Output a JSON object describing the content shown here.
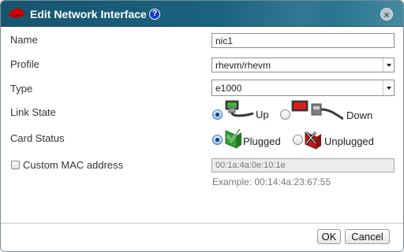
{
  "dialog": {
    "title": "Edit Network Interface",
    "help_glyph": "?",
    "close_glyph": "×"
  },
  "form": {
    "name_label": "Name",
    "name_value": "nic1",
    "profile_label": "Profile",
    "profile_value": "rhevm/rhevm",
    "type_label": "Type",
    "type_value": "e1000",
    "link_state_label": "Link State",
    "link_up_label": "Up",
    "link_down_label": "Down",
    "link_state_selected": "Up",
    "card_status_label": "Card Status",
    "plugged_label": "Plugged",
    "unplugged_label": "Unplugged",
    "card_status_selected": "Plugged",
    "custom_mac_label": "Custom MAC address",
    "custom_mac_checked": false,
    "mac_value": "00:1a:4a:0e:10:1e",
    "mac_example": "Example: 00:14:4a:23:67:55"
  },
  "buttons": {
    "ok_label": "OK",
    "cancel_label": "Cancel"
  },
  "colors": {
    "titlebar": "#1b6380",
    "help_badge": "#1c3fb8",
    "plugged_green": "#2fa32f",
    "unplugged_red": "#c41818"
  },
  "icons": {
    "title_logo": "redhat-shadowman-icon",
    "help": "help-icon",
    "close": "close-icon",
    "link_up": "cable-connected-icon",
    "link_down": "cable-disconnected-icon",
    "plugged": "nic-plugged-icon",
    "unplugged": "nic-unplugged-icon"
  }
}
